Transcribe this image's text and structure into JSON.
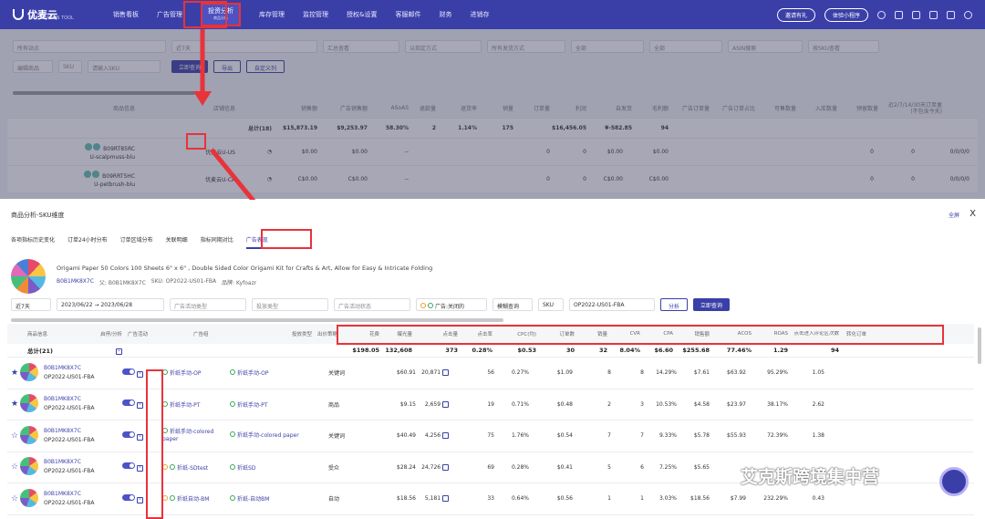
{
  "topnav": {
    "logo": "优麦云",
    "logo_sub": "ERP AMAZON TOOL",
    "items": [
      "销售看板",
      "广告管理",
      "投资分析",
      "库存管理",
      "监控管理",
      "授权&设置",
      "客服邮件",
      "财务",
      "进销存"
    ],
    "active_sub": "商品分析",
    "pill1": "邀请有礼",
    "pill2": "体验小程序"
  },
  "bg_filters": {
    "row1": [
      "所有站点",
      "近7天",
      "汇总查看",
      "以指定方式",
      "所有发货方式",
      "全部",
      "全部",
      "ASIN搜索",
      "按SKU查看"
    ],
    "row2": [
      "编辑商品",
      "SKU",
      "请输入SKU"
    ],
    "query": "立即查询",
    "export": "导出",
    "custom": "自定义列"
  },
  "bg_table": {
    "headers": [
      "商品信息",
      "店铺信息",
      "",
      "销售额",
      "广告销售额",
      "ASoAS",
      "退款量",
      "退货率",
      "销量",
      "订单量",
      "利润",
      "自发货",
      "毛利额",
      "广告订单量",
      "广告订单占比",
      "可售数量",
      "入库数量",
      "预留数量",
      "近2/7/14/30天订单量"
    ],
    "header_sub": "(不包含今天)",
    "total_label": "总计(18)",
    "total": [
      "$15,873.19",
      "$9,253.97",
      "58.30%",
      "2",
      "1.14%",
      "175",
      "",
      "$16,456.05",
      "¥-582.85",
      "94"
    ],
    "rows": [
      {
        "asin": "B09RT85RC",
        "sku": "U-scalpmuss-blu",
        "shop": "优麦云U-US",
        "v1": "$0.00",
        "v2": "$0.00",
        "v3": "--",
        "v4": "0",
        "v5": "0",
        "v6": "$0.00",
        "v7": "$0.00",
        "v8": "0",
        "v9": "0",
        "v10": "0/0/0/0"
      },
      {
        "asin": "B09RRT5HC",
        "sku": "U-petbrush-blu",
        "shop": "优麦云U-CA",
        "v1": "C$0.00",
        "v2": "C$0.00",
        "v3": "--",
        "v4": "0",
        "v5": "0",
        "v6": "C$0.00",
        "v7": "C$0.00",
        "v8": "0",
        "v9": "0",
        "v10": "0/0/0/0"
      }
    ]
  },
  "panel": {
    "title": "商品分析-SKU维度",
    "fullscreen": "全屏",
    "close": "X",
    "tabs": [
      "各项指标历史变化",
      "订单24小时分布",
      "订单区域分布",
      "关联明细",
      "指标同期对比",
      "广告表现"
    ],
    "product_title": "Origami Paper 50 Colors 100 Sheets 6\" x 6\" , Double Sided Color Origami Kit for Crafts & Art, Allow for Easy & Intricate Folding",
    "asin_label": "B0B1MK8X7C",
    "parent_label": "父: B0B1MK8X7C",
    "sku_label": "SKU: OP2022-US01-FBA",
    "brand_label": "品牌: Kyfoazr"
  },
  "panel_filters": {
    "range": "近7天",
    "start": "2023/06/22",
    "end": "2023/06/28",
    "f1": "广告活动类型",
    "f2": "投放类型",
    "f3": "广告活动状态",
    "status": "广告:关闭的",
    "search_type": "模糊查询",
    "sku_sel": "SKU",
    "sku_value": "OP2022-US01-FBA",
    "analyze": "分析",
    "query": "立即查询"
  },
  "grid": {
    "headers": [
      "商品信息",
      "启停/分析",
      "广告活动",
      "广告组",
      "投放类型",
      "出价策略",
      "花费",
      "曝光量",
      "点击量",
      "点击率",
      "CPC(均)",
      "订单数",
      "销量",
      "CVR",
      "CPA",
      "销售额",
      "ACOS",
      "ROAS",
      "点击进入评论区次数",
      "转化订单"
    ],
    "total_label": "总计(21)",
    "total": {
      "spend": "$198.05",
      "impr": "132,608",
      "clicks": "373",
      "ctr": "0.28%",
      "cpc": "$0.53",
      "orders": "30",
      "units": "32",
      "cvr": "8.04%",
      "cpa": "$6.60",
      "sales": "$255.68",
      "acos": "77.46%",
      "roas": "1.29",
      "extra": "94"
    },
    "rows": [
      {
        "asin": "B0B1MK8X7C",
        "sku": "OP2022-US01-FBA",
        "campaign": "折纸手动-OP",
        "group": "折纸手动-OP",
        "type": "关键词",
        "spend": "$60.91",
        "impr": "20,871",
        "clicks": "56",
        "ctr": "0.27%",
        "cpc": "$1.09",
        "orders": "8",
        "units": "8",
        "cvr": "14.29%",
        "cpa": "$7.61",
        "sales": "$63.92",
        "acos": "95.29%",
        "roas": "1.05",
        "starred": "★",
        "status": "ok"
      },
      {
        "asin": "B0B1MK8X7C",
        "sku": "OP2022-US01-FBA",
        "campaign": "折纸手动-PT",
        "group": "折纸手动-PT",
        "type": "商品",
        "spend": "$9.15",
        "impr": "2,659",
        "clicks": "19",
        "ctr": "0.71%",
        "cpc": "$0.48",
        "orders": "2",
        "units": "3",
        "cvr": "10.53%",
        "cpa": "$4.58",
        "sales": "$23.97",
        "acos": "38.17%",
        "roas": "2.62",
        "starred": "★",
        "status": "ok"
      },
      {
        "asin": "B0B1MK8X7C",
        "sku": "OP2022-US01-FBA",
        "campaign": "折纸手动-colored paper",
        "group": "折纸手动-colored paper",
        "type": "关键词",
        "spend": "$40.49",
        "impr": "4,256",
        "clicks": "75",
        "ctr": "1.76%",
        "cpc": "$0.54",
        "orders": "7",
        "units": "7",
        "cvr": "9.33%",
        "cpa": "$5.78",
        "sales": "$55.93",
        "acos": "72.39%",
        "roas": "1.38",
        "starred": "☆",
        "status": "ok"
      },
      {
        "asin": "B0B1MK8X7C",
        "sku": "OP2022-US01-FBA",
        "campaign": "折纸-SDtest",
        "group": "折纸SD",
        "type": "受众",
        "spend": "$28.24",
        "impr": "24,726",
        "clicks": "69",
        "ctr": "0.28%",
        "cpc": "$0.41",
        "orders": "5",
        "units": "6",
        "cvr": "7.25%",
        "cpa": "$5.65",
        "sales": "",
        "acos": "",
        "roas": "",
        "starred": "☆",
        "status": "warn"
      },
      {
        "asin": "B0B1MK8X7C",
        "sku": "OP2022-US01-FBA",
        "campaign": "折纸自动-BM",
        "group": "折纸-自动BM",
        "type": "自动",
        "spend": "$18.56",
        "impr": "5,181",
        "clicks": "33",
        "ctr": "0.64%",
        "cpc": "$0.56",
        "orders": "1",
        "units": "1",
        "cvr": "3.03%",
        "cpa": "$18.56",
        "sales": "$7.99",
        "acos": "232.29%",
        "roas": "0.43",
        "starred": "☆",
        "status": "ok"
      }
    ]
  },
  "watermark": "艾克斯跨境集中营",
  "colors": {
    "brand": "#3a3fa8",
    "highlight": "#e8333a"
  }
}
